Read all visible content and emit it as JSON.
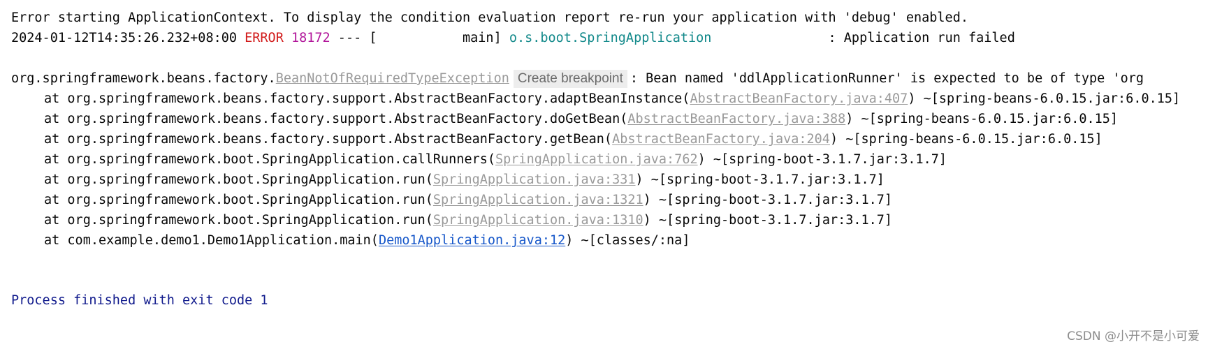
{
  "log": {
    "line1": "Error starting ApplicationContext. To display the condition evaluation report re-run your application with 'debug' enabled.",
    "line2": {
      "timestamp": "2024-01-12T14:35:26.232+08:00 ",
      "level": "ERROR",
      "pid": " 18172",
      "sep": " --- [           main] ",
      "logger": "o.s.boot.SpringApplication",
      "message": "               : Application run failed"
    },
    "exception": {
      "prefix": "org.springframework.beans.factory.",
      "class_name": "BeanNotOfRequiredTypeException",
      "tooltip": "Create breakpoint",
      "message": ": Bean named 'ddlApplicationRunner' is expected to be of type 'org"
    },
    "frames": [
      {
        "prefix": "at org.springframework.beans.factory.support.AbstractBeanFactory.adaptBeanInstance(",
        "link": "AbstractBeanFactory.java:407",
        "suffix": ") ~[spring-beans-6.0.15.jar:6.0.15]"
      },
      {
        "prefix": "at org.springframework.beans.factory.support.AbstractBeanFactory.doGetBean(",
        "link": "AbstractBeanFactory.java:388",
        "suffix": ") ~[spring-beans-6.0.15.jar:6.0.15]"
      },
      {
        "prefix": "at org.springframework.beans.factory.support.AbstractBeanFactory.getBean(",
        "link": "AbstractBeanFactory.java:204",
        "suffix": ") ~[spring-beans-6.0.15.jar:6.0.15]"
      },
      {
        "prefix": "at org.springframework.boot.SpringApplication.callRunners(",
        "link": "SpringApplication.java:762",
        "suffix": ") ~[spring-boot-3.1.7.jar:3.1.7]"
      },
      {
        "prefix": "at org.springframework.boot.SpringApplication.run(",
        "link": "SpringApplication.java:331",
        "suffix": ") ~[spring-boot-3.1.7.jar:3.1.7]"
      },
      {
        "prefix": "at org.springframework.boot.SpringApplication.run(",
        "link": "SpringApplication.java:1321",
        "suffix": ") ~[spring-boot-3.1.7.jar:3.1.7]"
      },
      {
        "prefix": "at org.springframework.boot.SpringApplication.run(",
        "link": "SpringApplication.java:1310",
        "suffix": ") ~[spring-boot-3.1.7.jar:3.1.7]"
      },
      {
        "prefix": "at com.example.demo1.Demo1Application.main(",
        "link": "Demo1Application.java:12",
        "suffix": ") ~[classes/:na]"
      }
    ],
    "exit_message": "Process finished with exit code 1"
  },
  "watermark": "CSDN @小开不是小可爱",
  "colors": {
    "error": "#d11a1a",
    "pid": "#b1159a",
    "logger": "#12898a",
    "library_link": "#9a9a9a",
    "user_link": "#1556c9",
    "exit": "#101a8c"
  }
}
